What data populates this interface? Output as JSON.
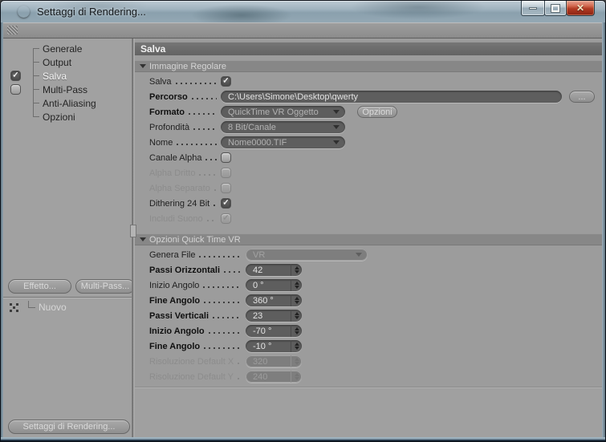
{
  "window": {
    "title": "Settaggi di Rendering...",
    "colors": {
      "close_button_red": "#b13a22",
      "field_dark": "#5e5e5e",
      "panel_gray": "#9c9c9c",
      "titlebar_glass": "#9fb2be"
    }
  },
  "sidebar": {
    "items": [
      {
        "label": "Generale",
        "checkbox": null,
        "selected": false
      },
      {
        "label": "Output",
        "checkbox": null,
        "selected": false
      },
      {
        "label": "Salva",
        "checkbox": "checked",
        "selected": true
      },
      {
        "label": "Multi-Pass",
        "checkbox": "unchecked",
        "selected": false
      },
      {
        "label": "Anti-Aliasing",
        "checkbox": null,
        "selected": false
      },
      {
        "label": "Opzioni",
        "checkbox": null,
        "selected": false
      }
    ],
    "effect_button": "Effetto...",
    "multipass_button": "Multi-Pass...",
    "new_item": "Nuovo",
    "render_settings_button": "Settaggi di Rendering..."
  },
  "main": {
    "header": "Salva",
    "section_regular": {
      "title": "Immagine Regolare",
      "salva": {
        "label": "Salva",
        "checked": true
      },
      "percorso": {
        "label": "Percorso",
        "value": "C:\\Users\\Simone\\Desktop\\qwerty",
        "browse": "..."
      },
      "formato": {
        "label": "Formato",
        "value": "QuickTime VR Oggetto",
        "button": "Opzioni"
      },
      "profondita": {
        "label": "Profondità",
        "value": "8 Bit/Canale"
      },
      "nome": {
        "label": "Nome",
        "value": "Nome0000.TIF"
      },
      "canale_alpha": {
        "label": "Canale Alpha",
        "checked": false
      },
      "alpha_dritto": {
        "label": "Alpha Dritto",
        "checked": false,
        "disabled": true
      },
      "alpha_separato": {
        "label": "Alpha Separato",
        "checked": false,
        "disabled": true
      },
      "dithering": {
        "label": "Dithering 24 Bit",
        "checked": true
      },
      "includi_suono": {
        "label": "Includi Suono",
        "checked": true,
        "disabled": true
      }
    },
    "section_qtvr": {
      "title": "Opzioni Quick Time VR",
      "genera_file": {
        "label": "Genera File",
        "value": "VR"
      },
      "passi_orizzontali": {
        "label": "Passi Orizzontali",
        "value": "42"
      },
      "inizio_angolo_1": {
        "label": "Inizio Angolo",
        "value": "0 °"
      },
      "fine_angolo_1": {
        "label": "Fine Angolo",
        "value": "360 °"
      },
      "passi_verticali": {
        "label": "Passi Verticali",
        "value": "23"
      },
      "inizio_angolo_2": {
        "label": "Inizio Angolo",
        "value": "-70 °"
      },
      "fine_angolo_2": {
        "label": "Fine Angolo",
        "value": "-10 °"
      },
      "ris_x": {
        "label": "Risoluzione Default X",
        "value": "320",
        "disabled": true
      },
      "ris_y": {
        "label": "Risoluzione Default Y",
        "value": "240",
        "disabled": true
      }
    }
  }
}
